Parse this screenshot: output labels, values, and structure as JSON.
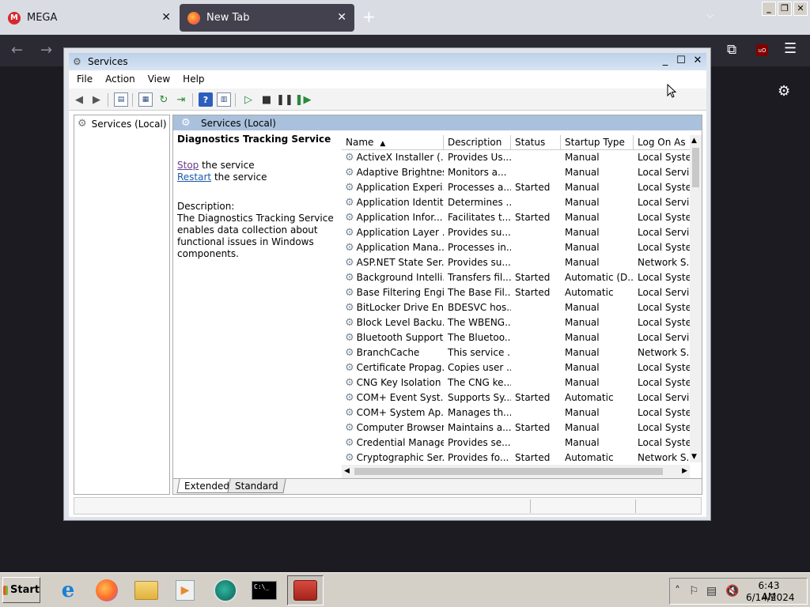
{
  "browser": {
    "tabs": [
      {
        "label": "MEGA"
      },
      {
        "label": "New Tab"
      }
    ]
  },
  "window": {
    "title": "Services",
    "menu": [
      "File",
      "Action",
      "View",
      "Help"
    ]
  },
  "tree": {
    "root": "Services (Local)"
  },
  "panel": {
    "header": "Services (Local)",
    "service_name": "Diagnostics Tracking Service",
    "stop_link": "Stop",
    "stop_rest": " the service",
    "restart_link": "Restart",
    "restart_rest": " the service",
    "description_label": "Description:",
    "description_text": "The Diagnostics Tracking Service enables data collection about functional issues in Windows components."
  },
  "table": {
    "columns": [
      "Name",
      "Description",
      "Status",
      "Startup Type",
      "Log On As"
    ],
    "rows": [
      [
        "ActiveX Installer (...",
        "Provides Us...",
        "",
        "Manual",
        "Local Syste..."
      ],
      [
        "Adaptive Brightness",
        "Monitors a...",
        "",
        "Manual",
        "Local Servic"
      ],
      [
        "Application Experi...",
        "Processes a...",
        "Started",
        "Manual",
        "Local Syste..."
      ],
      [
        "Application Identity",
        "Determines ...",
        "",
        "Manual",
        "Local Servic"
      ],
      [
        "Application Infor...",
        "Facilitates t...",
        "Started",
        "Manual",
        "Local Syste..."
      ],
      [
        "Application Layer ...",
        "Provides su...",
        "",
        "Manual",
        "Local Servic"
      ],
      [
        "Application Mana...",
        "Processes in...",
        "",
        "Manual",
        "Local Syste..."
      ],
      [
        "ASP.NET State Ser...",
        "Provides su...",
        "",
        "Manual",
        "Network S..."
      ],
      [
        "Background Intelli...",
        "Transfers fil...",
        "Started",
        "Automatic (D...",
        "Local Syste..."
      ],
      [
        "Base Filtering Engi...",
        "The Base Fil...",
        "Started",
        "Automatic",
        "Local Servic"
      ],
      [
        "BitLocker Drive En...",
        "BDESVC hos...",
        "",
        "Manual",
        "Local Syste..."
      ],
      [
        "Block Level Backu...",
        "The WBENG...",
        "",
        "Manual",
        "Local Syste..."
      ],
      [
        "Bluetooth Support...",
        "The Bluetoo...",
        "",
        "Manual",
        "Local Servic"
      ],
      [
        "BranchCache",
        "This service ...",
        "",
        "Manual",
        "Network S..."
      ],
      [
        "Certificate Propag...",
        "Copies user ...",
        "",
        "Manual",
        "Local Syste..."
      ],
      [
        "CNG Key Isolation",
        "The CNG ke...",
        "",
        "Manual",
        "Local Syste..."
      ],
      [
        "COM+ Event Syst...",
        "Supports Sy...",
        "Started",
        "Automatic",
        "Local Servic"
      ],
      [
        "COM+ System Ap...",
        "Manages th...",
        "",
        "Manual",
        "Local Syste..."
      ],
      [
        "Computer Browser",
        "Maintains a...",
        "Started",
        "Manual",
        "Local Syste..."
      ],
      [
        "Credential Manager",
        "Provides se...",
        "",
        "Manual",
        "Local Syste..."
      ],
      [
        "Cryptographic Ser...",
        "Provides fo...",
        "Started",
        "Automatic",
        "Network S..."
      ]
    ]
  },
  "view_tabs": [
    "Extended",
    "Standard"
  ],
  "taskbar": {
    "start": "Start",
    "time": "6:43 AM",
    "date": "6/14/2024"
  },
  "icons": [
    "mega-icon",
    "firefox-icon",
    "services-icon",
    "gear-icon",
    "back-icon",
    "forward-icon",
    "refresh-icon",
    "play-icon",
    "stop-icon",
    "pause-icon",
    "restart-icon",
    "help-icon"
  ],
  "colors": {
    "browser_bg": "#1c1b22",
    "title_gradient": "#bcd1ea",
    "panel_header": "#a9c1dc",
    "link": "#1b5aa8"
  }
}
